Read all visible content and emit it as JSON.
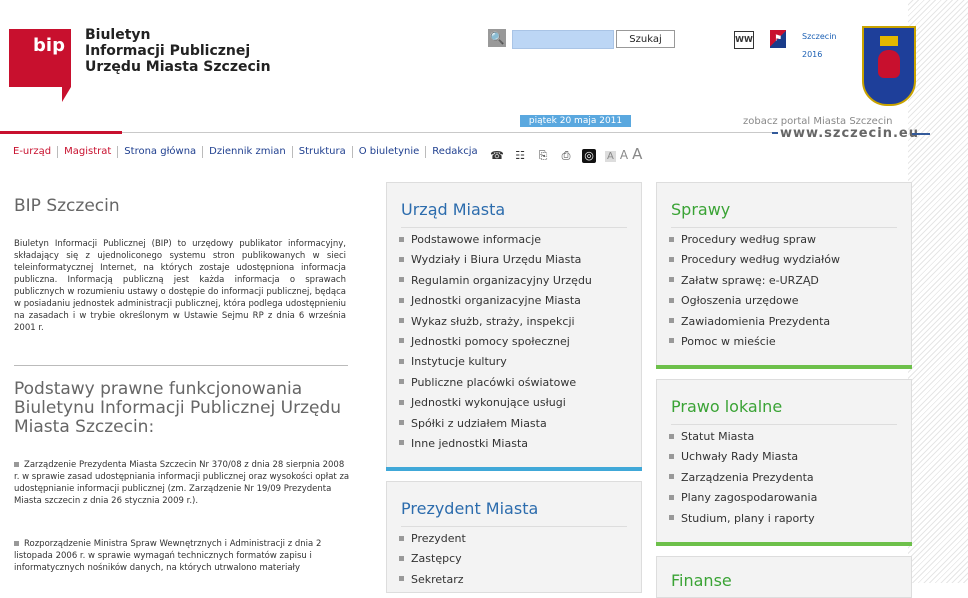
{
  "header": {
    "logo_text": "bip",
    "title_lines": [
      "Biuletyn",
      "Informacji Publicznej",
      "Urzędu Miasta Szczecin"
    ],
    "search": {
      "placeholder": "",
      "button_label": "Szukaj"
    },
    "icon_ww_label": "WW",
    "city_logo_label": "Szczecin 2016",
    "date": "piątek 20 maja 2011",
    "portal_caption": "zobacz portal Miasta Szczecin",
    "portal_url": "www.szczecin.eu"
  },
  "nav": {
    "items": [
      "E-urząd",
      "Magistrat",
      "Strona główna",
      "Dziennik zmian",
      "Struktura",
      "O biuletynie",
      "Redakcja"
    ]
  },
  "tools": {
    "icons": [
      "phone-icon",
      "sitemap-icon",
      "document-icon",
      "print-icon",
      "contrast-icon"
    ],
    "font_sizes": [
      "A",
      "A",
      "A"
    ]
  },
  "left": {
    "bip_title": "BIP Szczecin",
    "bip_paragraph": "Biuletyn Informacji Publicznej (BIP) to urzędowy publikator informacyjny, składający się z ujednoliconego systemu stron publikowanych w sieci teleinformatycznej Internet, na których zostaje udostępniona informacja publiczna. Informacją publiczną jest każda informacja o sprawach publicznych w rozumieniu ustawy o dostępie do informacji publicznej, będąca w posiadaniu jednostek administracji publicznej, która podlega udostępnieniu na zasadach i w trybie określonym w Ustawie Sejmu RP z dnia 6 września 2001 r.",
    "podstawy_title": "Podstawy prawne funkcjonowania Biuletynu Informacji Publicznej Urzędu Miasta Szczecin:",
    "laws": [
      "Zarządzenie Prezydenta Miasta Szczecin Nr 370/08 z dnia 28 sierpnia 2008 r. w sprawie zasad udostępniania informacji publicznej oraz wysokości opłat za udostępnianie informacji publicznej (zm. Zarządzenie Nr 19/09 Prezydenta Miasta szczecin z dnia 26 stycznia 2009 r.).",
      "Rozporządzenie Ministra Spraw Wewnętrznych i Administracji z dnia 2 listopada 2006 r. w sprawie wymagań technicznych formatów zapisu i informatycznych nośników danych, na których utrwalono materiały"
    ]
  },
  "urzad": {
    "title": "Urząd Miasta",
    "items": [
      "Podstawowe informacje",
      "Wydziały i Biura Urzędu Miasta",
      "Regulamin organizacyjny Urzędu",
      "Jednostki organizacyjne Miasta",
      "Wykaz służb, straży, inspekcji",
      "Jednostki pomocy społecznej",
      "Instytucje kultury",
      "Publiczne placówki oświatowe",
      "Jednostki wykonujące usługi",
      "Spółki z udziałem Miasta",
      "Inne jednostki Miasta"
    ]
  },
  "prezydent": {
    "title": "Prezydent Miasta",
    "items": [
      "Prezydent",
      "Zastępcy",
      "Sekretarz"
    ]
  },
  "sprawy": {
    "title": "Sprawy",
    "items": [
      "Procedury według spraw",
      "Procedury według wydziałów",
      "Załatw sprawę: e-URZĄD",
      "Ogłoszenia urzędowe",
      "Zawiadomienia Prezydenta",
      "Pomoc w mieście"
    ]
  },
  "prawo": {
    "title": "Prawo lokalne",
    "items": [
      "Statut Miasta",
      "Uchwały Rady Miasta",
      "Zarządzenia Prezydenta",
      "Plany zagospodarowania",
      "Studium, plany i raporty"
    ]
  },
  "finanse": {
    "title": "Finanse"
  },
  "colors": {
    "brand_red": "#c8102e",
    "link_blue": "#1f3f8f",
    "accent_blue": "#40a8d8",
    "accent_green": "#6dc04a"
  }
}
